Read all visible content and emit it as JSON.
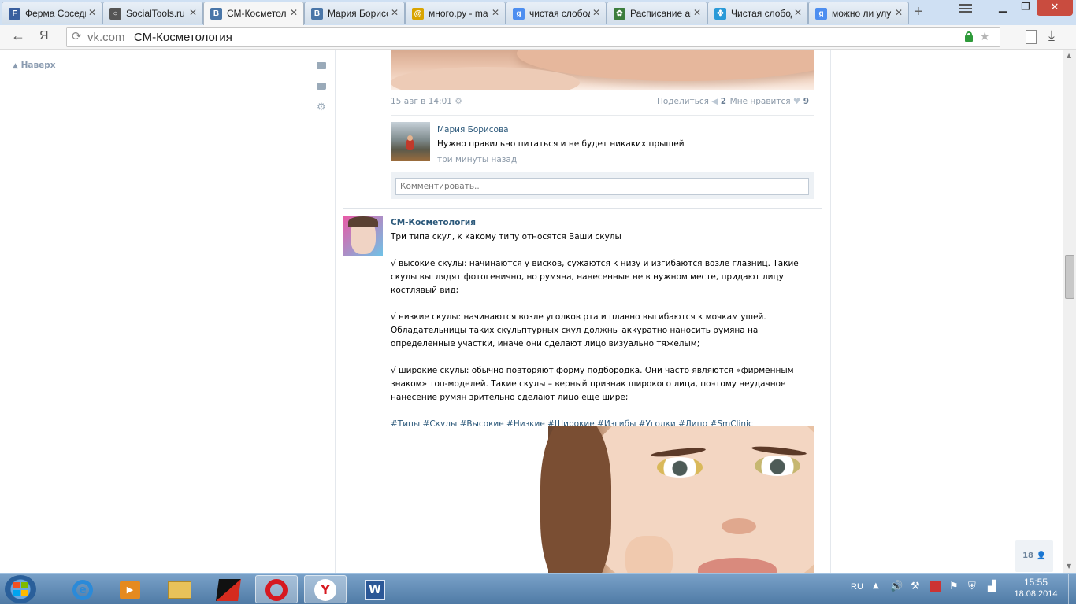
{
  "browser": {
    "tabs": [
      {
        "label": "Ферма Соседи",
        "favicon": "ferma-favicon",
        "color": "#3a5f9e",
        "glyph": "F"
      },
      {
        "label": "SocialTools.ru",
        "favicon": "socialtools-favicon",
        "color": "#555555",
        "glyph": "○"
      },
      {
        "label": "СМ-Косметол",
        "favicon": "vk-favicon",
        "color": "#4a76a8",
        "glyph": "В"
      },
      {
        "label": "Мария Борисо",
        "favicon": "vk-favicon",
        "color": "#4a76a8",
        "glyph": "В"
      },
      {
        "label": "много.ру - ma",
        "favicon": "mnogo-favicon",
        "color": "#d9a400",
        "glyph": "@"
      },
      {
        "label": "чистая слобод",
        "favicon": "google-favicon",
        "color": "#4d8ef0",
        "glyph": "g"
      },
      {
        "label": "Расписание ав",
        "favicon": "bus-favicon",
        "color": "#3c7d3c",
        "glyph": "✿"
      },
      {
        "label": "Чистая слобод",
        "favicon": "sloboda-favicon",
        "color": "#2a9ad8",
        "glyph": "✤"
      },
      {
        "label": "можно ли улу",
        "favicon": "google-favicon",
        "color": "#4d8ef0",
        "glyph": "g"
      }
    ],
    "active_tab": 2,
    "address_domain": "vk.com",
    "address_title": "СМ-Косметология",
    "yandex_glyph": "Я"
  },
  "page": {
    "back_to_top": "Наверх",
    "post1": {
      "date": "15 авг в 14:01",
      "share_label": "Поделиться",
      "share_count": "2",
      "dislike_label": "Мне нравится",
      "like_count": "9",
      "comment": {
        "author": "Мария Борисова",
        "text": "Нужно правильно питаться и не будет никаких прыщей",
        "time": "три минуты назад"
      },
      "comment_placeholder": "Комментировать.."
    },
    "post2": {
      "author": "СМ-Косметология",
      "intro": "Три типа скул, к какому типу относятся Ваши скулы",
      "p1": "√ высокие скулы: начинаются у висков, сужаются к низу и изгибаются возле глазниц. Такие скулы выглядят фотогенично, но румяна, нанесенные не в нужном месте, придают лицу костлявый вид;",
      "p2": "√ низкие скулы: начинаются возле уголков рта и плавно выгибаются к мочкам ушей. Обладательницы таких скульптурных скул должны аккуратно наносить румяна на определенные участки, иначе они сделают лицо визуально тяжелым;",
      "p3": "√ широкие скулы: обычно повторяют форму подбородка. Они часто являются «фирменным знаком» топ-моделей. Такие скулы – верный признак широкого лица, поэтому неудачное нанесение румян зрительно сделают лицо еще шире;",
      "hashtags": [
        "#Типы",
        "#Скулы",
        "#Высокие",
        "#Низкие",
        "#Широкие",
        "#Изгибы",
        "#Уголки",
        "#Лицо",
        "#SmClinic"
      ]
    },
    "online_count": "18"
  },
  "taskbar": {
    "language": "RU",
    "time": "15:55",
    "date": "18.08.2014"
  }
}
